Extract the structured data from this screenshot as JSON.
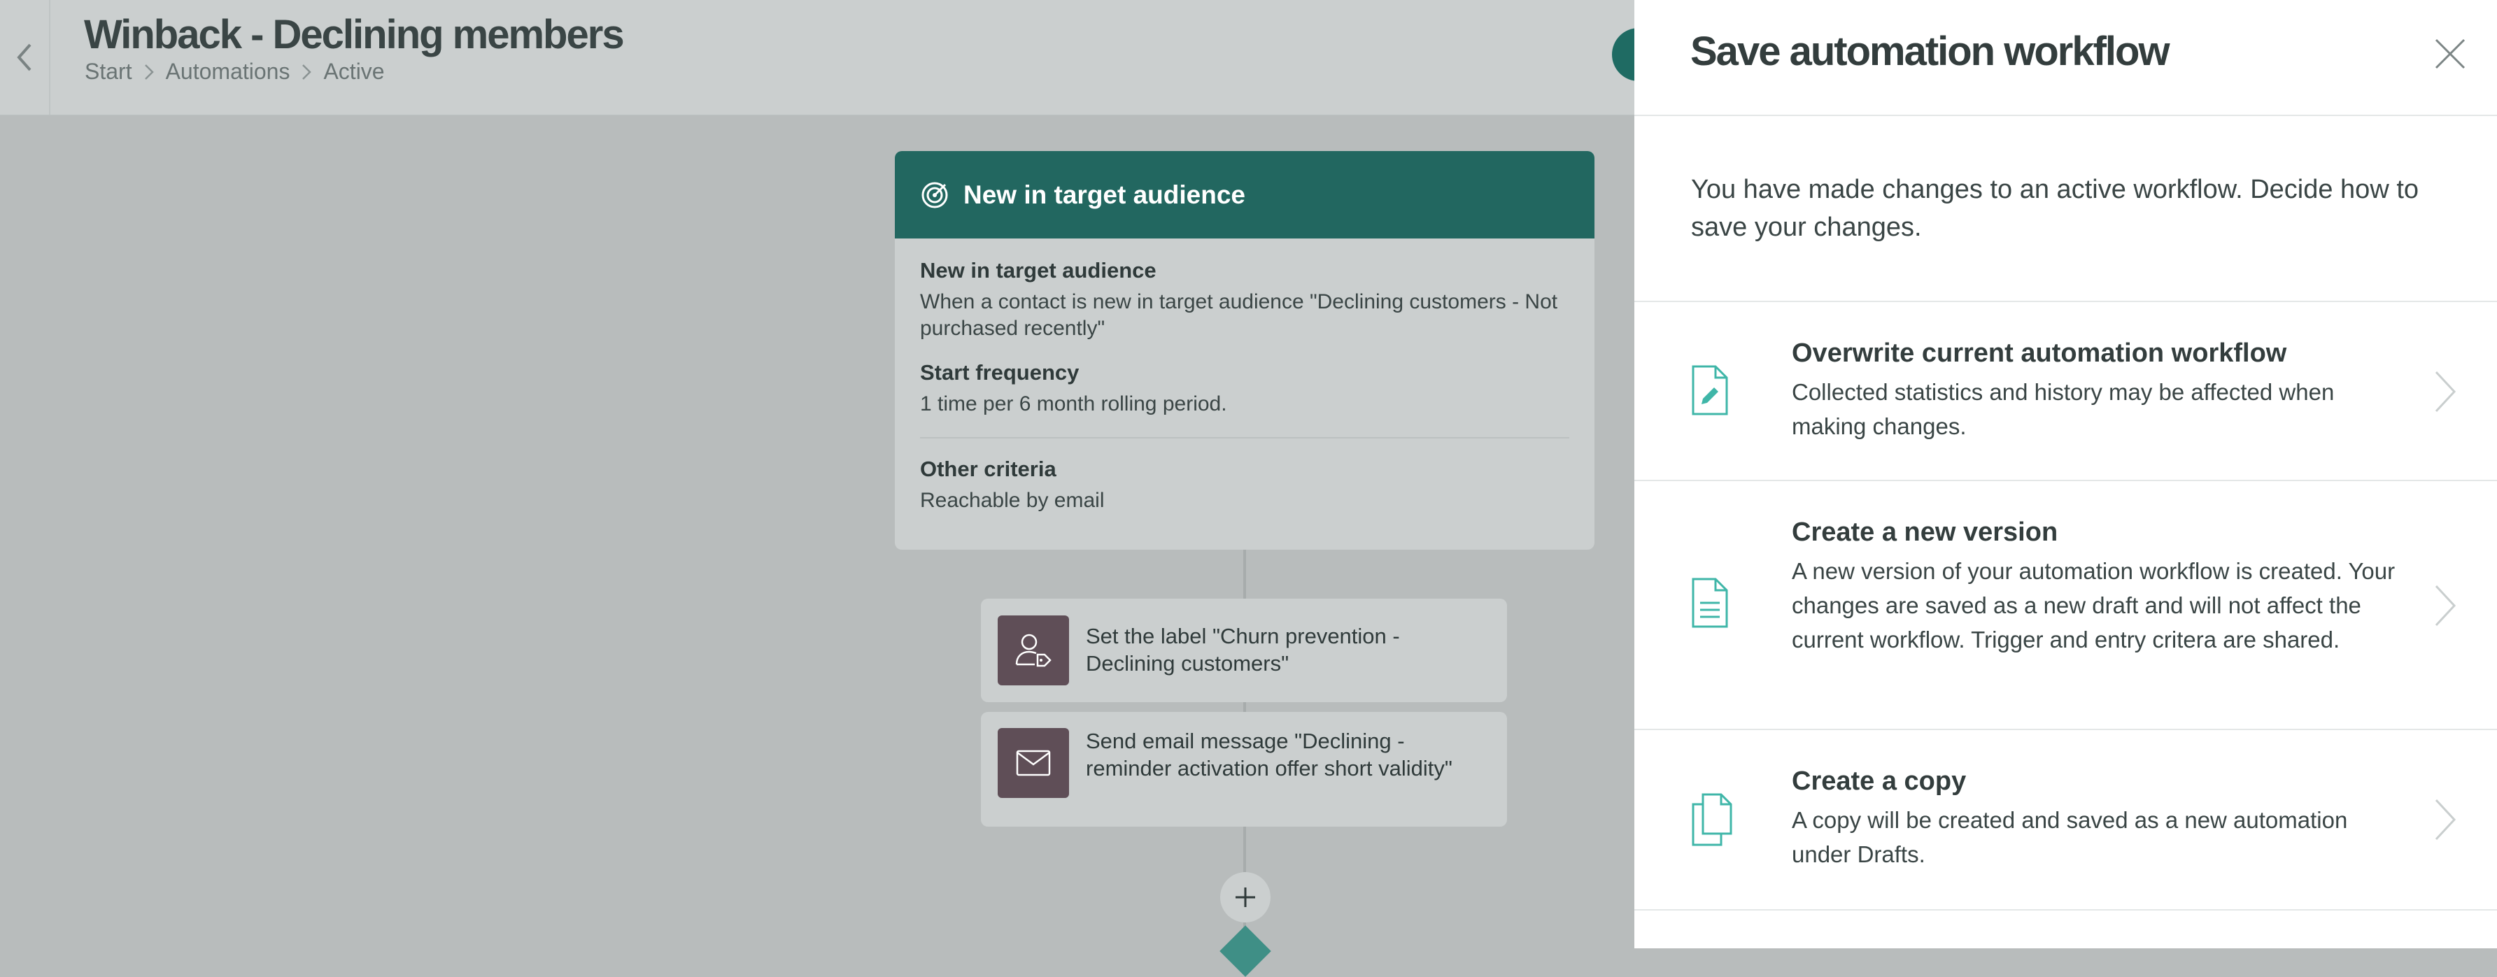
{
  "header": {
    "title": "Winback - Declining members",
    "breadcrumb": [
      "Start",
      "Automations",
      "Active"
    ]
  },
  "trigger": {
    "title": "New in target audience",
    "section1_label": "New in target audience",
    "section1_text": "When a contact is new in target audience \"Declining customers - Not purchased recently\"",
    "section2_label": "Start frequency",
    "section2_text": "1 time per 6 month rolling period.",
    "section3_label": "Other criteria",
    "section3_text": "Reachable by email"
  },
  "actions": [
    {
      "icon": "user-tag-icon",
      "text": "Set the label \"Churn prevention - Declining customers\""
    },
    {
      "icon": "envelope-icon",
      "text": "Send email message \"Declining - reminder activation offer short validity\""
    }
  ],
  "add_step_icon": "plus-icon",
  "panel": {
    "title": "Save automation workflow",
    "intro": "You have made changes to an active workflow. Decide how to save your changes.",
    "options": [
      {
        "icon": "edit-document-icon",
        "title": "Overwrite current automation workflow",
        "description": "Collected statistics and history may be affected when making changes."
      },
      {
        "icon": "document-icon",
        "title": "Create a new version",
        "description": "A new version of your automation workflow is created. Your changes are saved as a new draft and will not affect the current workflow. Trigger and entry critera are shared."
      },
      {
        "icon": "copy-icon",
        "title": "Create a copy",
        "description": "A copy will be created and saved as a new automation under Drafts."
      }
    ]
  },
  "colors": {
    "brand": "#226760",
    "accent_icon": "#3fb6a8",
    "action_icon_bg": "#5f4e57",
    "overlay": "#b8bcbc"
  }
}
